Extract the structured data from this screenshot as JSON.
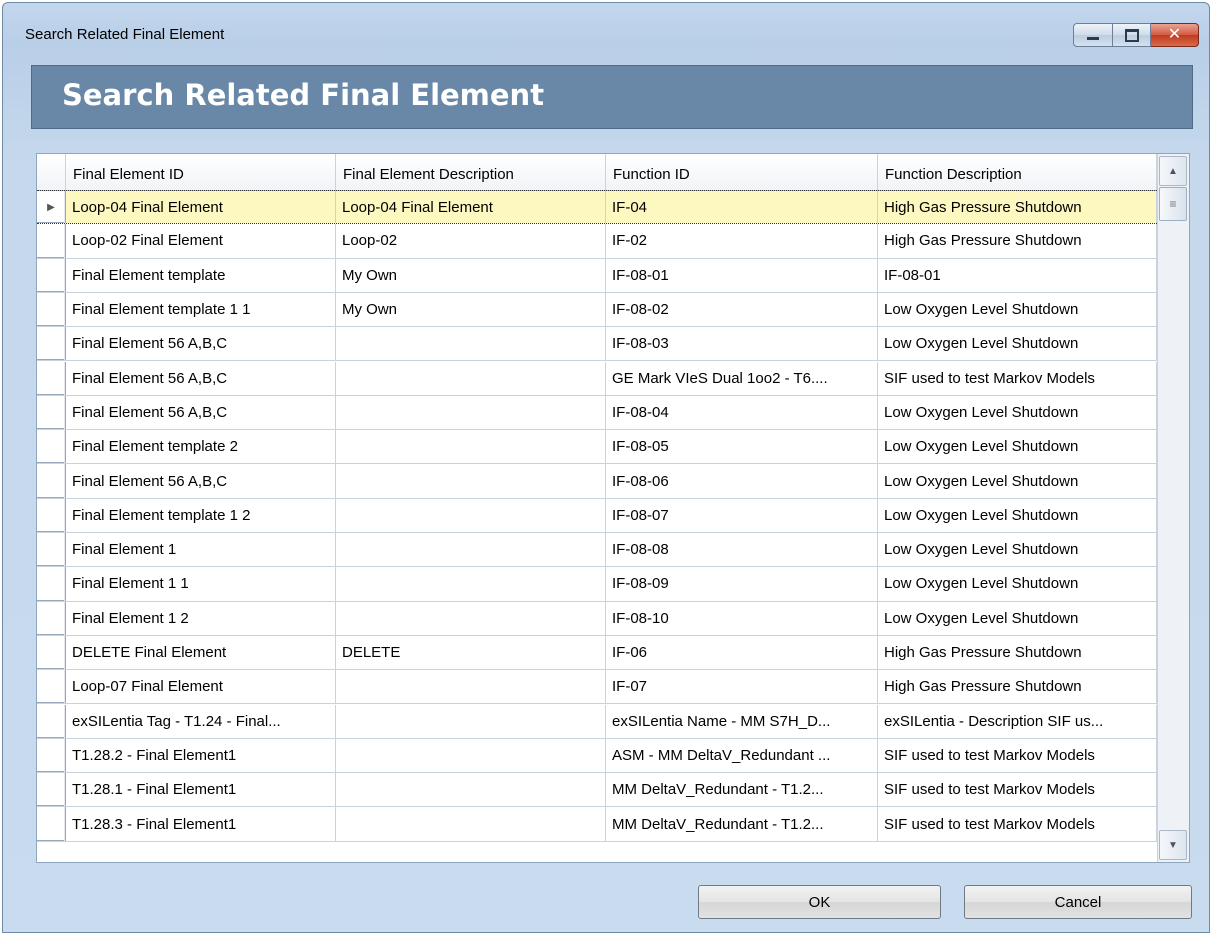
{
  "window": {
    "title": "Search Related Final Element",
    "banner_title": "Search Related Final Element"
  },
  "grid": {
    "columns": [
      "Final Element ID",
      "Final Element Description",
      "Function ID",
      "Function Description"
    ],
    "rows": [
      [
        "Loop-04 Final Element",
        "Loop-04 Final Element",
        "IF-04",
        "High Gas Pressure Shutdown"
      ],
      [
        "Loop-02 Final Element",
        "Loop-02",
        "IF-02",
        "High Gas Pressure Shutdown"
      ],
      [
        "Final Element template",
        "My Own",
        "IF-08-01",
        "IF-08-01"
      ],
      [
        "Final Element template 1 1",
        "My Own",
        "IF-08-02",
        "Low Oxygen Level Shutdown"
      ],
      [
        "Final Element 56 A,B,C",
        "",
        "IF-08-03",
        "Low Oxygen Level Shutdown"
      ],
      [
        "Final Element 56 A,B,C",
        "",
        "GE Mark VIeS Dual 1oo2 - T6....",
        "SIF used to test Markov Models"
      ],
      [
        "Final Element 56 A,B,C",
        "",
        "IF-08-04",
        "Low Oxygen Level Shutdown"
      ],
      [
        "Final Element template 2",
        "",
        "IF-08-05",
        "Low Oxygen Level Shutdown"
      ],
      [
        "Final Element 56 A,B,C",
        "",
        "IF-08-06",
        "Low Oxygen Level Shutdown"
      ],
      [
        "Final Element template 1 2",
        "",
        "IF-08-07",
        "Low Oxygen Level Shutdown"
      ],
      [
        "Final Element 1",
        "",
        "IF-08-08",
        "Low Oxygen Level Shutdown"
      ],
      [
        "Final Element 1 1",
        "",
        "IF-08-09",
        "Low Oxygen Level Shutdown"
      ],
      [
        "Final Element 1 2",
        "",
        "IF-08-10",
        "Low Oxygen Level Shutdown"
      ],
      [
        "DELETE Final Element",
        "DELETE",
        "IF-06",
        "High Gas Pressure Shutdown"
      ],
      [
        "Loop-07 Final Element",
        "",
        "IF-07",
        "High Gas Pressure Shutdown"
      ],
      [
        "exSILentia Tag - T1.24 - Final...",
        "",
        "exSILentia Name - MM S7H_D...",
        "exSILentia - Description SIF us..."
      ],
      [
        "T1.28.2 - Final Element1",
        "",
        "ASM - MM DeltaV_Redundant ...",
        "SIF used to test Markov Models"
      ],
      [
        "T1.28.1 - Final Element1",
        "",
        "MM DeltaV_Redundant - T1.2...",
        "SIF used to test Markov Models"
      ],
      [
        "T1.28.3 - Final Element1",
        "",
        "MM DeltaV_Redundant - T1.2...",
        "SIF used to test Markov Models"
      ]
    ],
    "selected_row": 0
  },
  "buttons": {
    "ok": "OK",
    "cancel": "Cancel"
  },
  "icons": {
    "minimize": "minimize-icon",
    "maximize": "maximize-icon",
    "close": "close-icon",
    "row_pointer": "row-pointer-icon"
  },
  "colors": {
    "banner": "#6987a6",
    "selected_row": "#fdf8c0",
    "close_button": "#c13a1f"
  }
}
